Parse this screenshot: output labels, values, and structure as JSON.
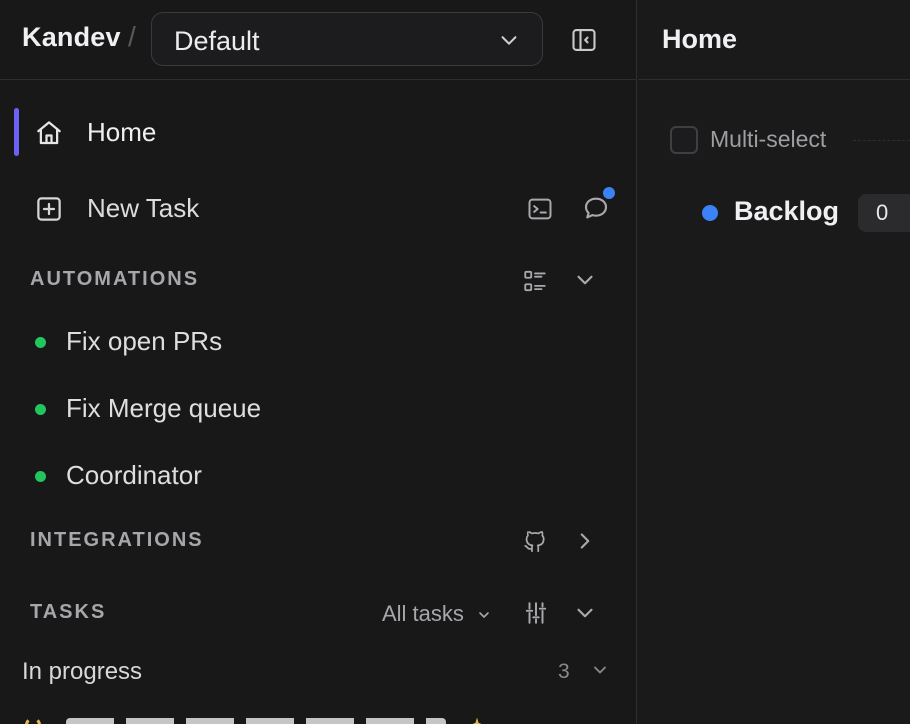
{
  "sidebar": {
    "brand": "Kandev",
    "separator": "/",
    "workspace": {
      "selected": "Default"
    },
    "nav": [
      {
        "label": "Home",
        "icon": "home-icon",
        "active": true
      },
      {
        "label": "New Task",
        "icon": "plus-square-icon"
      }
    ],
    "automations": {
      "title": "AUTOMATIONS",
      "items": [
        {
          "label": "Fix open PRs",
          "status_color": "#22c55e"
        },
        {
          "label": "Fix Merge queue",
          "status_color": "#22c55e"
        },
        {
          "label": "Coordinator",
          "status_color": "#22c55e"
        }
      ]
    },
    "integrations": {
      "title": "INTEGRATIONS",
      "icon": "github-icon"
    },
    "tasks": {
      "title": "TASKS",
      "filter": "All tasks",
      "group": {
        "label": "In progress",
        "count": "3"
      }
    }
  },
  "main": {
    "title": "Home",
    "multiselect_label": "Multi-select",
    "columns": [
      {
        "title": "Backlog",
        "count": "0",
        "color": "#3b82f6"
      }
    ]
  },
  "colors": {
    "accent": "#6b63f6",
    "notification": "#3b82f6",
    "automation_active": "#22c55e"
  }
}
